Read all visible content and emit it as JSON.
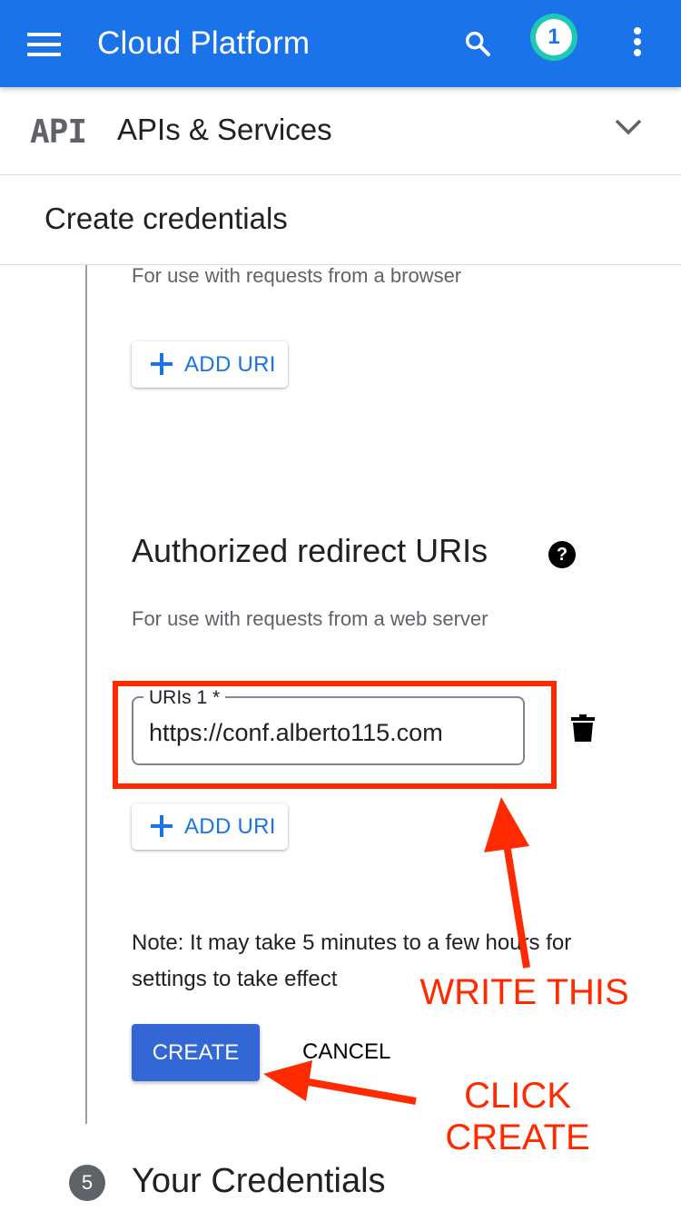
{
  "appbar": {
    "title": "Cloud Platform",
    "notification_count": "1",
    "icons": [
      "menu-icon",
      "search-icon",
      "more-vert-icon"
    ],
    "color": "#1a73e8"
  },
  "service": {
    "logo_text": "API",
    "title": "APIs & Services"
  },
  "page": {
    "title": "Create credentials"
  },
  "origins": {
    "helper": "For use with requests from a browser",
    "add_uri_label": "ADD URI"
  },
  "redirects": {
    "heading": "Authorized redirect URIs",
    "help_glyph": "?",
    "helper": "For use with requests from a web server",
    "field_label": "URIs 1 *",
    "field_value": "https://conf.alberto115.com",
    "add_uri_label": "ADD URI"
  },
  "note": "Note: It may take 5 minutes to a few hours for settings to take effect",
  "actions": {
    "create_label": "CREATE",
    "cancel_label": "CANCEL"
  },
  "annotations": {
    "write_this": "WRITE THIS",
    "click_create_line1": "CLICK",
    "click_create_line2": "CREATE",
    "color": "#ff2a00"
  },
  "next_step": {
    "number": "5",
    "title": "Your Credentials"
  }
}
